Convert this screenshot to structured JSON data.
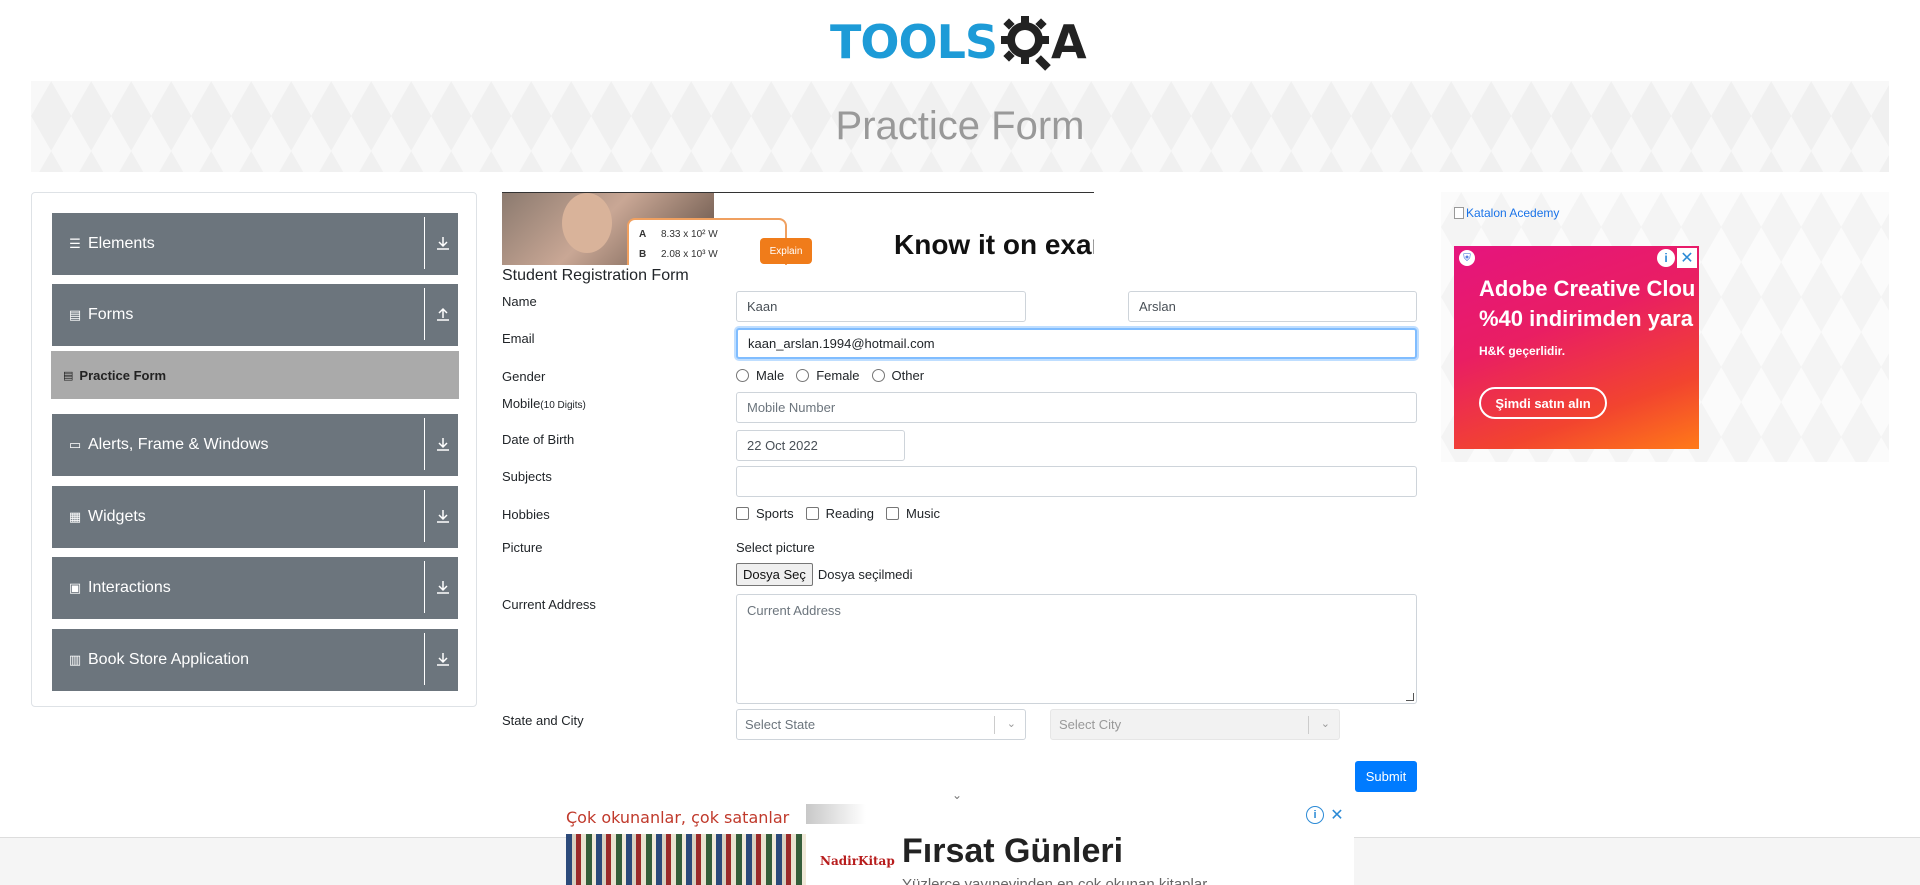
{
  "header": {
    "logo_tools": "TOOLS",
    "logo_a": "A",
    "brand_color": "#1d9bd7"
  },
  "banner": {
    "title": "Practice Form"
  },
  "sidebar": {
    "groups": [
      {
        "label": "Elements",
        "icon": "list-icon",
        "arrow": "download-icon"
      },
      {
        "label": "Forms",
        "icon": "form-icon",
        "arrow": "upload-icon",
        "expanded": true
      },
      {
        "label": "Alerts, Frame & Windows",
        "icon": "window-icon",
        "arrow": "download-icon"
      },
      {
        "label": "Widgets",
        "icon": "widgets-icon",
        "arrow": "download-icon"
      },
      {
        "label": "Interactions",
        "icon": "interactions-icon",
        "arrow": "download-icon"
      },
      {
        "label": "Book Store Application",
        "icon": "books-icon",
        "arrow": "download-icon"
      }
    ],
    "active_item": "Practice Form"
  },
  "top_ad": {
    "row_a": "8.33 x 10² W",
    "row_b": "2.08 x 10³ W",
    "letter_a": "A",
    "letter_b": "B",
    "button": "Explain",
    "headline": "Know it on exar"
  },
  "form": {
    "title": "Student Registration Form",
    "labels": {
      "name": "Name",
      "email": "Email",
      "gender": "Gender",
      "mobile": "Mobile",
      "mobile_hint": "(10 Digits)",
      "dob": "Date of Birth",
      "subjects": "Subjects",
      "hobbies": "Hobbies",
      "picture": "Picture",
      "address": "Current Address",
      "state_city": "State and City"
    },
    "first_name": "Kaan",
    "last_name": "Arslan",
    "email": "kaan_arslan.1994@hotmail.com",
    "gender_options": [
      "Male",
      "Female",
      "Other"
    ],
    "mobile_placeholder": "Mobile Number",
    "dob": "22 Oct 2022",
    "subjects": "",
    "hobbies": [
      "Sports",
      "Reading",
      "Music"
    ],
    "select_picture": "Select picture",
    "file_button": "Dosya Seç",
    "file_status": "Dosya seçilmedi",
    "address_placeholder": "Current Address",
    "state_placeholder": "Select State",
    "city_placeholder": "Select City",
    "submit": "Submit",
    "submit_color": "#007bff"
  },
  "right_ad": {
    "katalon_alt": "Katalon Acedemy",
    "line1": "Adobe Creative Clou",
    "line2": "%40 indirimden yara",
    "note": "H&K geçerlidir.",
    "cta": "Şimdi satın alın"
  },
  "bottom_ad": {
    "tagline": "Çok okunanlar, çok satanlar",
    "brand": "NadirKitap",
    "headline": "Fırsat Günleri",
    "sub": "Yüzlerce yayınevinden en çok okunan kitaplar"
  }
}
